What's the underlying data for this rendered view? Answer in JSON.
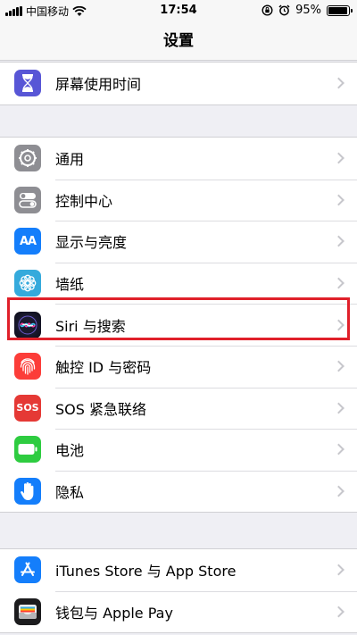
{
  "status_bar": {
    "carrier": "中国移动",
    "time": "17:54",
    "battery": "95%"
  },
  "nav": {
    "title": "设置"
  },
  "group1": [
    {
      "label": "屏幕使用时间",
      "icon": "hourglass-icon",
      "color": "#5856d6"
    }
  ],
  "group2": [
    {
      "label": "通用",
      "icon": "gear-icon",
      "color": "#8e8e93"
    },
    {
      "label": "控制中心",
      "icon": "toggles-icon",
      "color": "#8e8e93"
    },
    {
      "label": "显示与亮度",
      "icon": "display-aa-icon",
      "color": "#147efb"
    },
    {
      "label": "墙纸",
      "icon": "flower-icon",
      "color": "#35aadc"
    },
    {
      "label": "Siri 与搜索",
      "icon": "siri-icon",
      "color": "#1a1a2e"
    },
    {
      "label": "触控 ID 与密码",
      "icon": "fingerprint-icon",
      "color": "#fc3d39"
    },
    {
      "label": "SOS 紧急联络",
      "icon": "sos-icon",
      "color": "#e53935"
    },
    {
      "label": "电池",
      "icon": "battery-icon",
      "color": "#2ecc40"
    },
    {
      "label": "隐私",
      "icon": "hand-icon",
      "color": "#147efb"
    }
  ],
  "group3": [
    {
      "label": "iTunes Store 与 App Store",
      "icon": "app-store-icon",
      "color": "#147efb"
    },
    {
      "label": "钱包与 Apple Pay",
      "icon": "wallet-icon",
      "color": "#1c1c1e"
    }
  ],
  "icon_text": {
    "aa": "AA",
    "sos": "SOS"
  }
}
